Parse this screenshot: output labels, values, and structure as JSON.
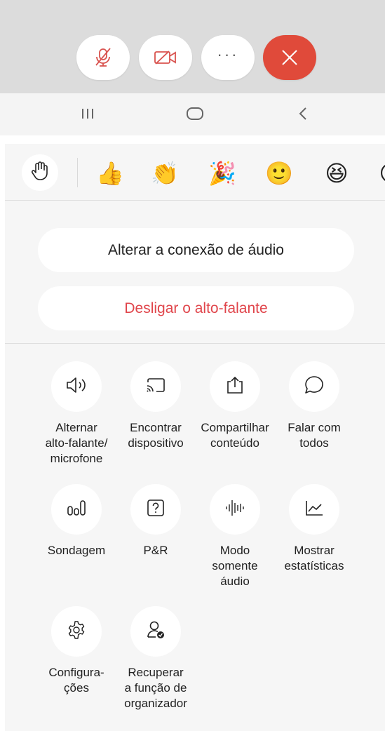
{
  "call_controls": {
    "mute": {
      "icon": "mic-off-icon"
    },
    "video": {
      "icon": "video-off-icon"
    },
    "more": {
      "icon": "more-icon",
      "label": "···"
    },
    "end": {
      "icon": "close-icon",
      "color": "#e04a3a"
    }
  },
  "nav_bar": {
    "recents": {
      "icon": "recents-icon",
      "glyph": "III"
    },
    "home": {
      "icon": "home-icon"
    },
    "back": {
      "icon": "back-icon",
      "glyph": "<"
    }
  },
  "reactions": {
    "raise_hand": {
      "icon": "raise-hand-icon"
    },
    "emojis": [
      {
        "name": "thumbs-up-icon",
        "glyph": "👍"
      },
      {
        "name": "clapping-icon",
        "glyph": "👏"
      },
      {
        "name": "party-popper-icon",
        "glyph": "🎉"
      },
      {
        "name": "smile-icon",
        "glyph": "🙂"
      },
      {
        "name": "laughing-icon",
        "glyph": "😆"
      },
      {
        "name": "partial-emoji-icon",
        "glyph": "😮"
      }
    ]
  },
  "audio_actions": {
    "change_connection": "Alterar a conexão de áudio",
    "speaker_off": "Desligar o alto-falante",
    "danger_color": "#e0454b"
  },
  "options": [
    {
      "id": "switch-speaker",
      "icon": "speaker-icon",
      "label": "Alternar\nalto-falante/\nmicrofone"
    },
    {
      "id": "find-device",
      "icon": "cast-icon",
      "label": "Encontrar\ndispositivo"
    },
    {
      "id": "share-content",
      "icon": "share-icon",
      "label": "Compartilhar\nconteúdo"
    },
    {
      "id": "chat-everyone",
      "icon": "chat-icon",
      "label": "Falar com\ntodos"
    },
    {
      "id": "polling",
      "icon": "poll-icon",
      "label": "Sondagem"
    },
    {
      "id": "qa",
      "icon": "question-icon",
      "label": "P&R"
    },
    {
      "id": "audio-only",
      "icon": "audio-wave-icon",
      "label": "Modo\nsomente\náudio"
    },
    {
      "id": "show-stats",
      "icon": "stats-icon",
      "label": "Mostrar\nestatísticas"
    },
    {
      "id": "settings",
      "icon": "gear-icon",
      "label": "Configura-\nções"
    },
    {
      "id": "reclaim-host",
      "icon": "user-check-icon",
      "label": "Recuperar\na função de\norganizador"
    }
  ]
}
